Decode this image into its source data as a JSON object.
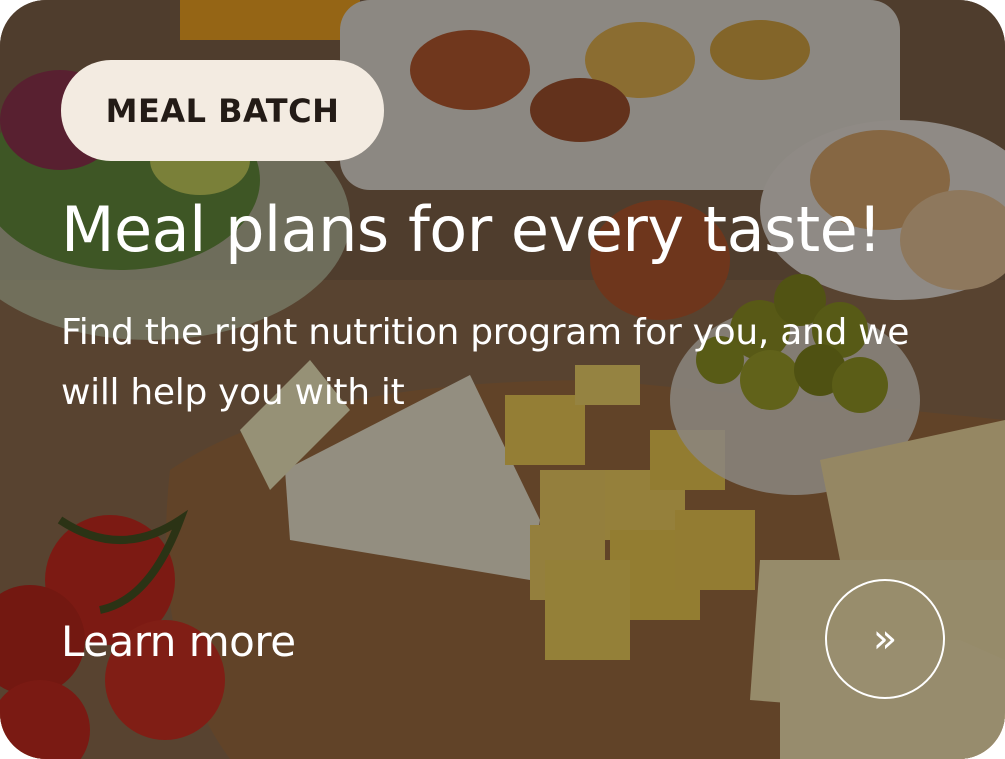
{
  "card": {
    "badge_label": "MEAL BATCH",
    "title": "Meal plans for every taste!",
    "subtitle": "Find the right nutrition program for you, and we will help you with it",
    "cta_label": "Learn more",
    "arrow_glyph": "»"
  },
  "colors": {
    "badge_bg": "#f3ebe1",
    "badge_text": "#231b16",
    "text": "#ffffff"
  },
  "icons": {
    "arrow": "double-chevron-right-icon"
  }
}
